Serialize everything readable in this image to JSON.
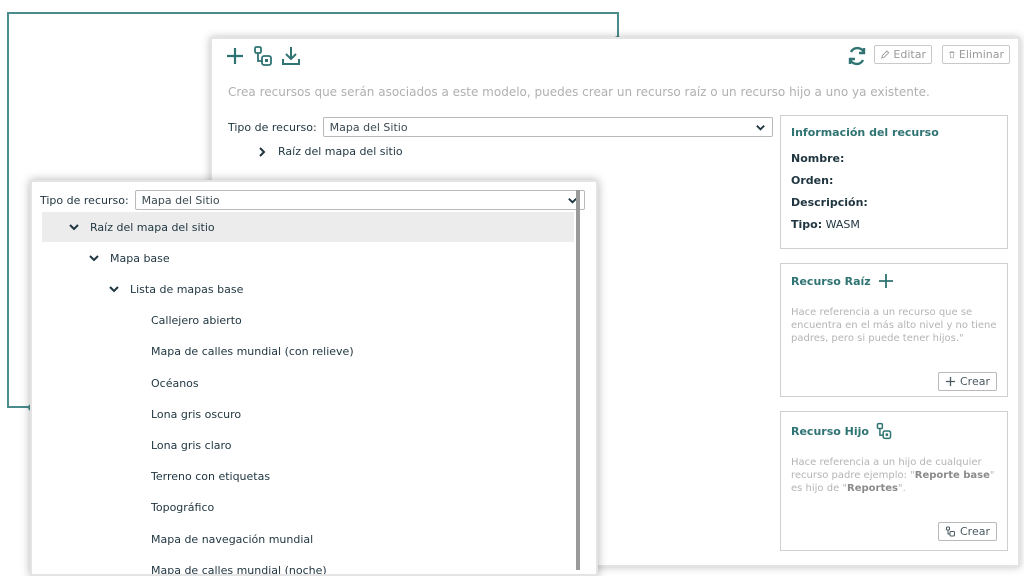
{
  "toolbar": {
    "add_icon": "plus-icon",
    "child_icon": "child-resource-icon",
    "download_icon": "download-icon",
    "refresh_icon": "refresh-icon",
    "edit_label": "Editar",
    "delete_label": "Eliminar"
  },
  "description": "Crea recursos que serán asociados a este modelo, puedes crear un recurso raíz o un recurso hijo a uno ya existente.",
  "main": {
    "tipo_label": "Tipo de recurso:",
    "tipo_value": "Mapa del Sitio",
    "tree_root": "Raíz del mapa del sitio"
  },
  "info_card": {
    "title": "Información del recurso",
    "nombre_label": "Nombre:",
    "orden_label": "Orden:",
    "descripcion_label": "Descripción:",
    "tipo_label": "Tipo:",
    "tipo_value": "WASM"
  },
  "root_card": {
    "title": "Recurso Raíz",
    "text": "Hace referencia a un recurso que se encuentra en el más alto nivel y no tiene padres, pero si puede tener hijos.\"",
    "button": "Crear"
  },
  "child_card": {
    "title": "Recurso Hijo",
    "text_pre": "Hace referencia a un hijo de cualquier recurso padre ejemplo: \"",
    "text_bold1": "Reporte base",
    "text_mid": "\" es hijo de \"",
    "text_bold2": "Reportes",
    "text_post": "\".",
    "button": "Crear"
  },
  "front": {
    "tipo_label": "Tipo de recurso:",
    "tipo_value": "Mapa del Sitio",
    "tree": [
      {
        "label": "Raíz del mapa del sitio",
        "level": 0,
        "expanded": true,
        "selected": true
      },
      {
        "label": "Mapa base",
        "level": 1,
        "expanded": true
      },
      {
        "label": "Lista de mapas base",
        "level": 2,
        "expanded": true
      },
      {
        "label": "Callejero abierto",
        "level": 3
      },
      {
        "label": "Mapa de calles mundial (con relieve)",
        "level": 3
      },
      {
        "label": "Océanos",
        "level": 3
      },
      {
        "label": "Lona gris oscuro",
        "level": 3
      },
      {
        "label": "Lona gris claro",
        "level": 3
      },
      {
        "label": "Terreno con etiquetas",
        "level": 3
      },
      {
        "label": "Topográfico",
        "level": 3
      },
      {
        "label": "Mapa de navegación mundial",
        "level": 3
      },
      {
        "label": "Mapa de calles mundial (noche)",
        "level": 3
      }
    ]
  },
  "colors": {
    "accent": "#2f7373",
    "connector": "#4a8c8c",
    "text_dark": "#1f3540",
    "text_muted": "#b0b0b0"
  }
}
